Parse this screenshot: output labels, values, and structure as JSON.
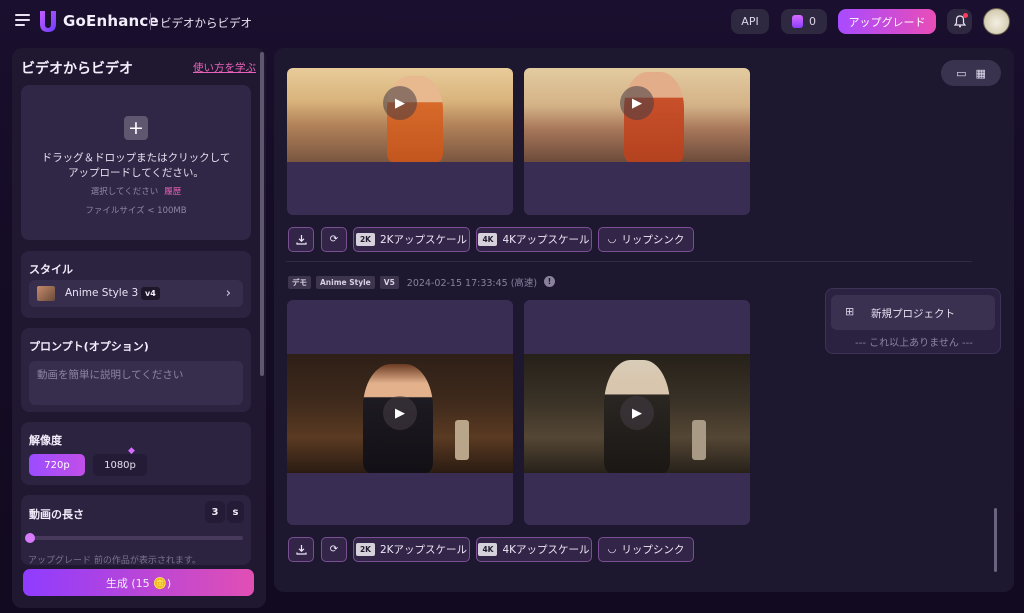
{
  "header": {
    "brand": "GoEnhance",
    "page_name": "ビデオからビデオ",
    "api_label": "API",
    "credits": "0",
    "upgrade_label": "アップグレード"
  },
  "sidebar": {
    "title": "ビデオからビデオ",
    "learn_link": "使い方を学ぶ",
    "upload": {
      "line1": "ドラッグ＆ドロップまたはクリックして",
      "line2": "アップロードしてください。",
      "select_hint": "選択してください",
      "history": "履歴",
      "size_limit": "ファイルサイズ < 100MB"
    },
    "style": {
      "label": "スタイル",
      "selected": "Anime Style 3",
      "version": "v4"
    },
    "prompt": {
      "label": "プロンプト(オプション)",
      "placeholder": "動画を簡単に説明してください"
    },
    "resolution": {
      "label": "解像度",
      "options": [
        "720p",
        "1080p"
      ],
      "selected": "720p"
    },
    "duration": {
      "label": "動画の長さ",
      "value": "3",
      "unit": "s",
      "slider_fraction": 0
    },
    "hint": "アップグレード 前の作品が表示されます。",
    "generate_label": "生成 (15 🪙)"
  },
  "main": {
    "actions": {
      "upscale_2k": "2Kアップスケール",
      "upscale_4k": "4Kアップスケール",
      "lipsync": "リップシンク",
      "badge_2k": "2K",
      "badge_4k": "4K"
    },
    "entry": {
      "tags": [
        "デモ",
        "Anime Style",
        "V5"
      ],
      "timestamp": "2024-02-15 17:33:45 (高速)"
    },
    "popup": {
      "new_project": "新規プロジェクト",
      "end_text": "--- これ以上ありません ---"
    }
  }
}
